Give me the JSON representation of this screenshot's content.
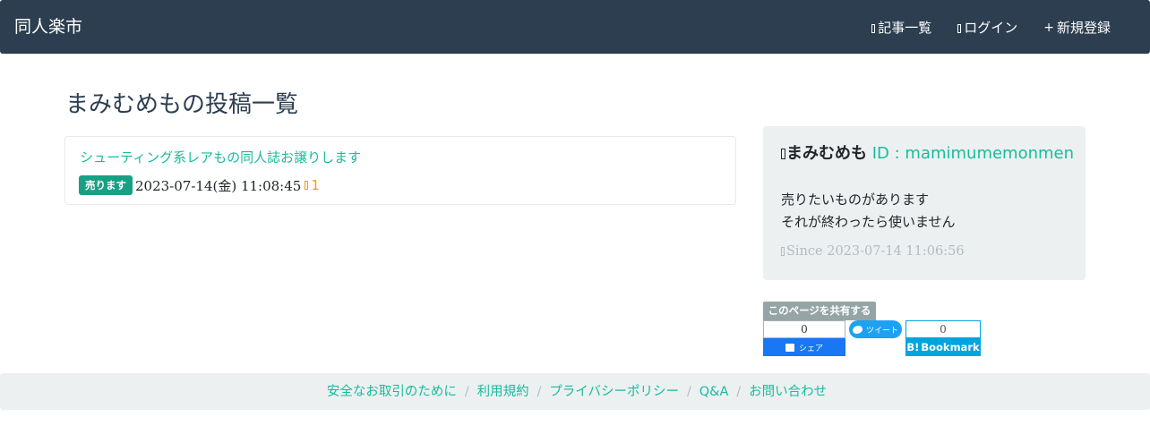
{
  "navbar": {
    "brand": "同人楽市",
    "links": [
      {
        "label": "記事一覧",
        "icon": "document-icon"
      },
      {
        "label": "ログイン",
        "icon": "login-icon"
      },
      {
        "label": "新規登録",
        "icon": "plus-icon",
        "symbol": "+"
      }
    ]
  },
  "page": {
    "title": "まみむめもの投稿一覧"
  },
  "posts": [
    {
      "title": "シューティング系レアもの同人誌お譲りします",
      "badge": "売ります",
      "date": "2023-07-14(金) 11:08:45",
      "favorites": "1"
    }
  ],
  "profile": {
    "name": "まみむめも",
    "id_text": "ID : mamimumemonmen",
    "bio_lines": [
      "売りたいものがあります",
      "それが終わったら使いません"
    ],
    "since": "Since 2023-07-14 11:06:56"
  },
  "share": {
    "label": "このページを共有する",
    "facebook": {
      "count": "0",
      "button_label": "シェア"
    },
    "twitter": {
      "button_label": "ツイート"
    },
    "hatena": {
      "count": "0",
      "logo": "B!",
      "button_label": "Bookmark"
    }
  },
  "footer": {
    "links": [
      "安全なお取引のために",
      "利用規約",
      "プライバシーポリシー",
      "Q&A",
      "お問い合わせ"
    ],
    "separator": "/"
  },
  "colors": {
    "navbar": "#2c3e50",
    "accent": "#18bc9c",
    "badge": "#18a085",
    "favorite": "#f39c12",
    "panel": "#ecf0f1"
  }
}
